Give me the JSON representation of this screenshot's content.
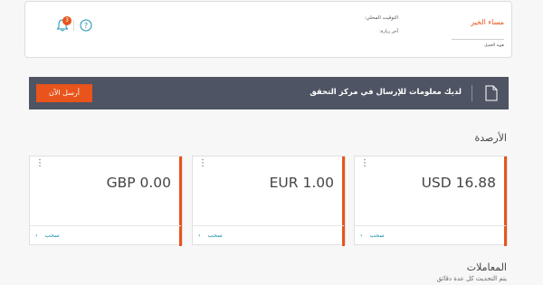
{
  "header": {
    "greeting": "مساء الخير",
    "customer_id_label": "هوية العميل",
    "local_time_label": "التوقيت المحلي:",
    "last_visit_label": "آخر زيارة:",
    "notification_count": "3"
  },
  "banner": {
    "message": "لديك معلومات للإرسال في مركز التحقق",
    "send_label": "أرسل الآن"
  },
  "balances": {
    "title": "الأرصدة",
    "cards": [
      {
        "amount": "USD 16.88",
        "withdraw_label": "سحب"
      },
      {
        "amount": "EUR 1.00",
        "withdraw_label": "سحب"
      },
      {
        "amount": "GBP 0.00",
        "withdraw_label": "سحب"
      }
    ]
  },
  "transactions": {
    "title": "المعاملات",
    "subtitle": "يتم التحديث كل عدة دقائق"
  },
  "colors": {
    "accent": "#e8541b",
    "banner_bg": "#4e5463",
    "link": "#1a8fb0"
  }
}
